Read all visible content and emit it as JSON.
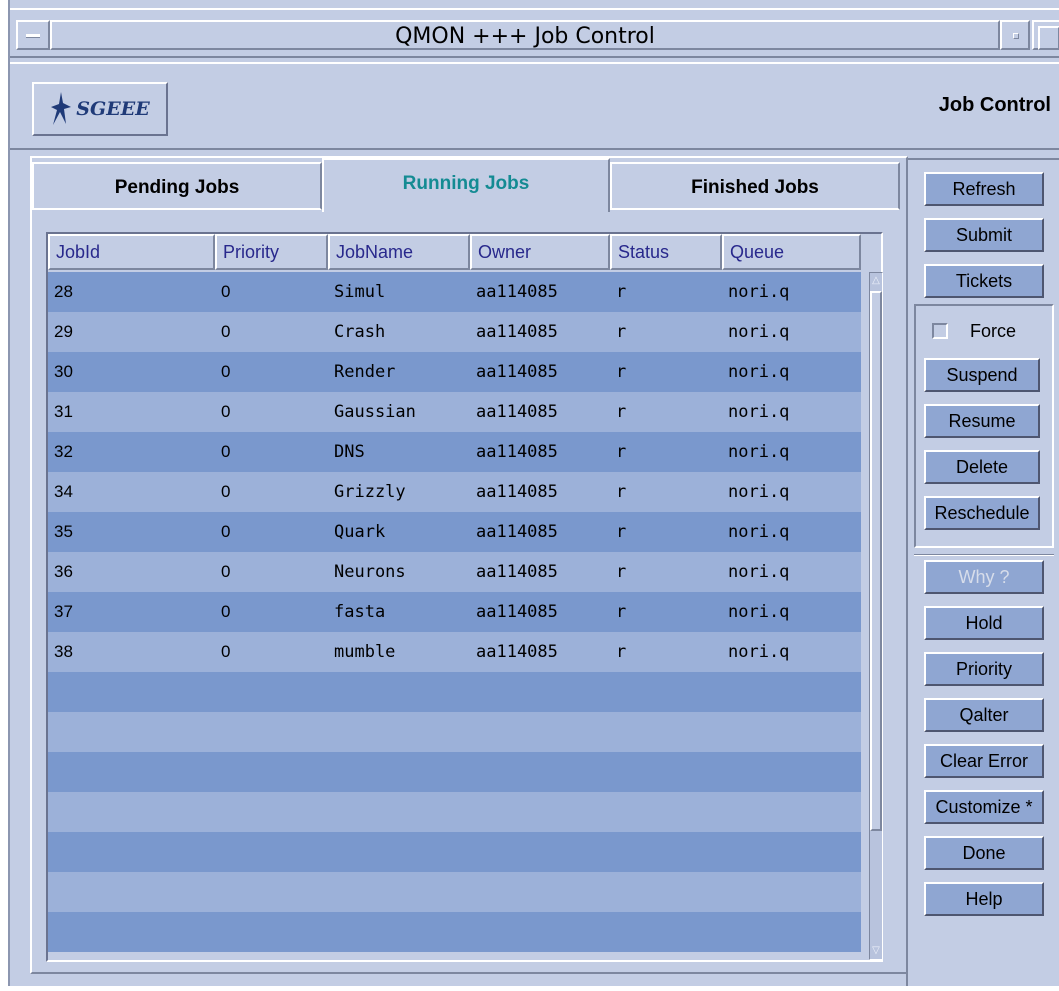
{
  "window": {
    "title": "QMON +++ Job Control"
  },
  "header": {
    "logo_text": "SGEEE",
    "title": "Job Control"
  },
  "tabs": [
    {
      "label": "Pending Jobs",
      "active": false
    },
    {
      "label": "Running Jobs",
      "active": true
    },
    {
      "label": "Finished Jobs",
      "active": false
    }
  ],
  "table": {
    "columns": [
      "JobId",
      "Priority",
      "JobName",
      "Owner",
      "Status",
      "Queue"
    ],
    "rows": [
      [
        "28",
        "0",
        "Simul",
        "aa114085",
        "r",
        "nori.q"
      ],
      [
        "29",
        "0",
        "Crash",
        "aa114085",
        "r",
        "nori.q"
      ],
      [
        "30",
        "0",
        "Render",
        "aa114085",
        "r",
        "nori.q"
      ],
      [
        "31",
        "0",
        "Gaussian",
        "aa114085",
        "r",
        "nori.q"
      ],
      [
        "32",
        "0",
        "DNS",
        "aa114085",
        "r",
        "nori.q"
      ],
      [
        "34",
        "0",
        "Grizzly",
        "aa114085",
        "r",
        "nori.q"
      ],
      [
        "35",
        "0",
        "Quark",
        "aa114085",
        "r",
        "nori.q"
      ],
      [
        "36",
        "0",
        "Neurons",
        "aa114085",
        "r",
        "nori.q"
      ],
      [
        "37",
        "0",
        "fasta",
        "aa114085",
        "r",
        "nori.q"
      ],
      [
        "38",
        "0",
        "mumble",
        "aa114085",
        "r",
        "nori.q"
      ]
    ]
  },
  "buttons": {
    "refresh": "Refresh",
    "submit": "Submit",
    "tickets": "Tickets",
    "force": "Force",
    "suspend": "Suspend",
    "resume": "Resume",
    "delete": "Delete",
    "reschedule": "Reschedule",
    "why": "Why ?",
    "hold": "Hold",
    "priority": "Priority",
    "qalter": "Qalter",
    "clear_error": "Clear Error",
    "customize": "Customize *",
    "done": "Done",
    "help": "Help"
  },
  "colors": {
    "window_bg": "#c3cde4",
    "row_dark": "#7a98cd",
    "row_light": "#9cb1d9",
    "button_bg": "#8fa6d2",
    "active_tab_text": "#148b93",
    "header_text": "#28288c"
  }
}
